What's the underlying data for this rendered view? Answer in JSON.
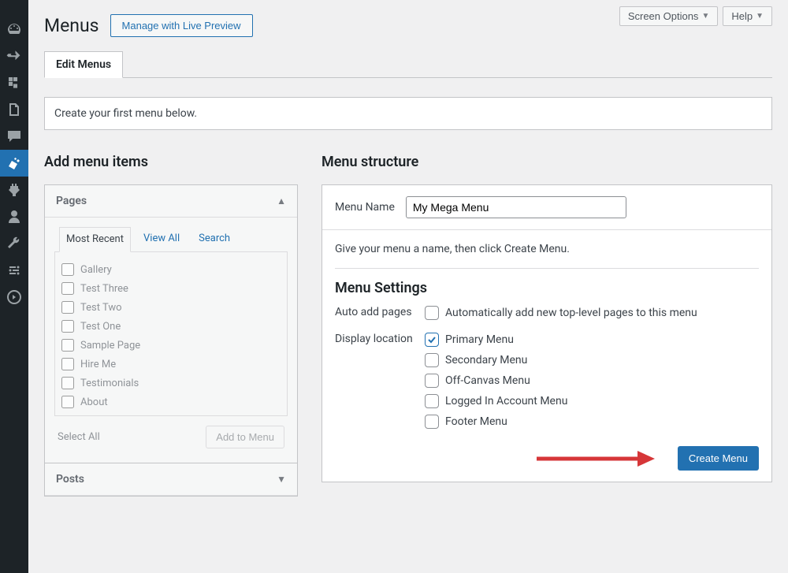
{
  "sidebar": {
    "items": [
      {
        "icon": "dashboard"
      },
      {
        "icon": "pin"
      },
      {
        "icon": "media"
      },
      {
        "icon": "pages"
      },
      {
        "icon": "comments"
      },
      {
        "icon": "appearance",
        "active": true
      },
      {
        "icon": "plugins"
      },
      {
        "icon": "users"
      },
      {
        "icon": "tools"
      },
      {
        "icon": "settings"
      },
      {
        "icon": "collapse"
      }
    ]
  },
  "topbar": {
    "screen_options": "Screen Options",
    "help": "Help"
  },
  "header": {
    "title": "Menus",
    "live_preview": "Manage with Live Preview"
  },
  "tabs": {
    "edit": "Edit Menus"
  },
  "notice": "Create your first menu below.",
  "left": {
    "title": "Add menu items",
    "pages_label": "Pages",
    "subtabs": [
      "Most Recent",
      "View All",
      "Search"
    ],
    "page_items": [
      "Gallery",
      "Test Three",
      "Test Two",
      "Test One",
      "Sample Page",
      "Hire Me",
      "Testimonials",
      "About"
    ],
    "select_all": "Select All",
    "add_btn": "Add to Menu",
    "posts_label": "Posts"
  },
  "right": {
    "title": "Menu structure",
    "menu_name_label": "Menu Name",
    "menu_name_value": "My Mega Menu",
    "instruction": "Give your menu a name, then click Create Menu.",
    "settings_head": "Menu Settings",
    "auto_add_label": "Auto add pages",
    "auto_add_text": "Automatically add new top-level pages to this menu",
    "display_location_label": "Display location",
    "locations": [
      {
        "label": "Primary Menu",
        "checked": true
      },
      {
        "label": "Secondary Menu",
        "checked": false
      },
      {
        "label": "Off-Canvas Menu",
        "checked": false
      },
      {
        "label": "Logged In Account Menu",
        "checked": false
      },
      {
        "label": "Footer Menu",
        "checked": false
      }
    ],
    "create_btn": "Create Menu"
  }
}
